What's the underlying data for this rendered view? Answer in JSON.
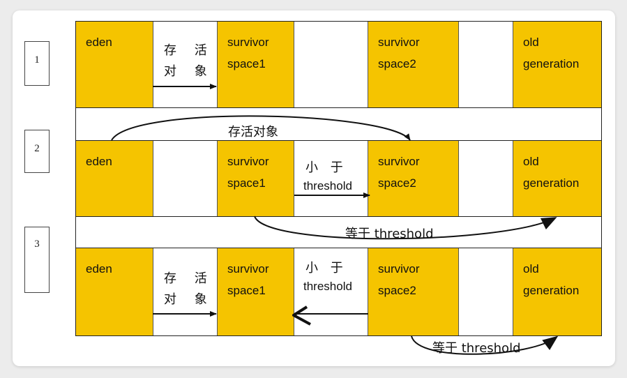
{
  "rows": [
    {
      "number": "1",
      "eden": "eden",
      "survivor1": [
        "survivor",
        "space1"
      ],
      "survivor2": [
        "survivor",
        "space2"
      ],
      "old": [
        "old",
        "generation"
      ],
      "gap1_label": [
        "存 活",
        "对 象"
      ],
      "gap2_label": []
    },
    {
      "number": "2",
      "eden": "eden",
      "survivor1": [
        "survivor",
        "space1"
      ],
      "survivor2": [
        "survivor",
        "space2"
      ],
      "old": [
        "old",
        "generation"
      ],
      "gap1_label": [],
      "gap2_label": [
        "小  于",
        "threshold"
      ]
    },
    {
      "number": "3",
      "eden": "eden",
      "survivor1": [
        "survivor",
        "space1"
      ],
      "survivor2": [
        "survivor",
        "space2"
      ],
      "old": [
        "old",
        "generation"
      ],
      "gap1_label": [
        "存 活",
        "对 象"
      ],
      "gap2_label": [
        "小  于",
        "threshold"
      ]
    }
  ],
  "between_labels": {
    "row1_to_row2": "存活对象",
    "row2_to_row3": "等于 threshold",
    "below_row3": "等于 threshold"
  },
  "colors": {
    "region_fill": "#f5c400",
    "gap_fill": "#ffffff",
    "arrow": "#111111"
  }
}
